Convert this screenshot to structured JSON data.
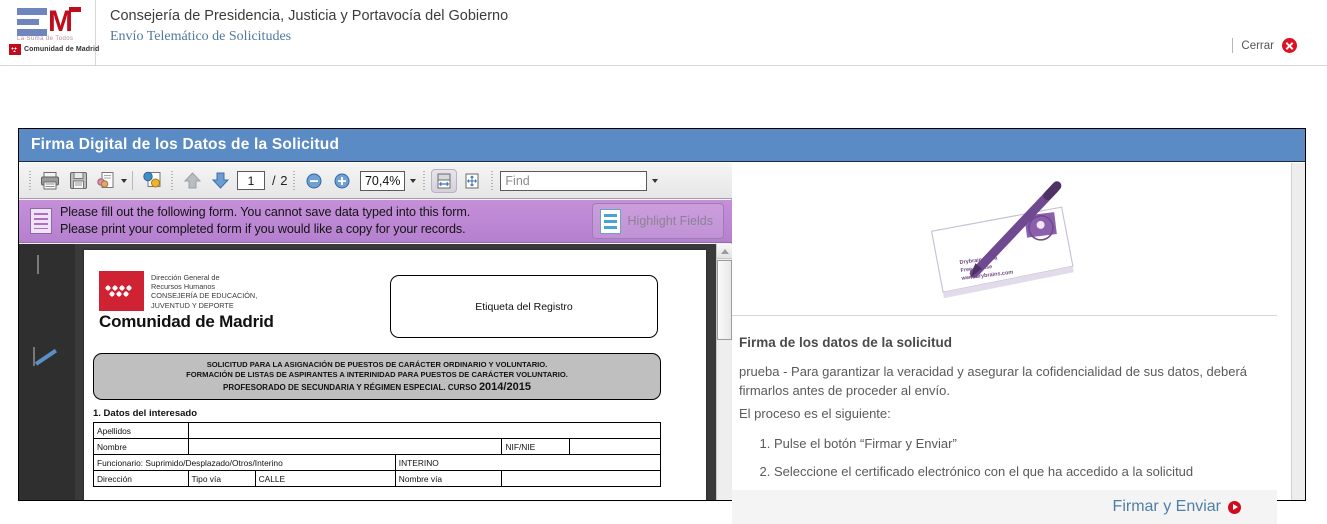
{
  "header": {
    "logo": {
      "letter_m": "M",
      "tagline": "La Suma de Todos",
      "region": "Comunidad de Madrid"
    },
    "title_main": "Consejería de Presidencia, Justicia y Portavocía del Gobierno",
    "title_sub": "Envío Telemático de Solicitudes",
    "close_label": "Cerrar"
  },
  "panel": {
    "title": "Firma Digital de los Datos de la Solicitud"
  },
  "pdf_toolbar": {
    "print_icon": "printer-icon",
    "save_icon": "floppy-disk-icon",
    "email_icon": "share-document-icon",
    "secure_icon": "secure-document-icon",
    "prev_icon": "arrow-up-icon",
    "next_icon": "arrow-down-icon",
    "page_current": "1",
    "page_total": "/ 2",
    "zoom_out_icon": "zoom-out-icon",
    "zoom_in_icon": "zoom-in-icon",
    "zoom_value": "70,4%",
    "fit_width_icon": "fit-width-icon",
    "fit_page_icon": "fit-page-icon",
    "find_placeholder": "Find",
    "find_value": ""
  },
  "notification": {
    "line1": "Please fill out the following form. You cannot save data typed into this form.",
    "line2": "Please print your completed form if you would like a copy for your records.",
    "highlight_label": "Highlight Fields"
  },
  "doc_sidebar": {
    "pages_icon": "pages-thumbnail-icon",
    "search_icon": "binoculars-search-icon",
    "signature_icon": "signature-pen-icon"
  },
  "pdf_page": {
    "logo_lines": [
      "Dirección General de",
      "Recursos Humanos",
      "CONSEJERÍA DE EDUCACIÓN,",
      "JUVENTUD Y DEPORTE"
    ],
    "comunidad": "Comunidad de Madrid",
    "etiqueta": "Etiqueta del Registro",
    "solicitud_line1": "SOLICITUD PARA LA ASIGNACIÓN DE PUESTOS DE CARÁCTER ORDINARIO Y VOLUNTARIO.",
    "solicitud_line2": "FORMACIÓN DE LISTAS DE ASPIRANTES A INTERINIDAD PARA PUESTOS DE CARÁCTER VOLUNTARIO.",
    "solicitud_line3": "PROFESORADO DE SECUNDARIA Y RÉGIMEN ESPECIAL. CURSO ",
    "solicitud_year": "2014/2015",
    "section_title": "1. Datos del interesado",
    "rows": {
      "apellidos_label": "Apellidos",
      "apellidos_value": "",
      "nombre_label": "Nombre",
      "nombre_value": "",
      "nif_label": "NIF/NIE",
      "nif_value": "",
      "funcionario_label": "Funcionario: Suprimido/Desplazado/Otros/Interino",
      "funcionario_value": "INTERINO",
      "direccion_label": "Dirección",
      "tipovia_label": "Tipo vía",
      "tipovia_value": "CALLE",
      "nombrevia_label": "Nombre vía",
      "nombrevia_value": ""
    }
  },
  "info": {
    "image_alt": "envelope-and-pen-image",
    "heading": "Firma de los datos de la solicitud",
    "paragraph1": "prueba - Para garantizar la veracidad y asegurar la cofidencialidad de sus datos, deberá firmarlos antes de proceder al envío.",
    "paragraph2": "El proceso es el siguiente:",
    "steps": [
      "Pulse el botón “Firmar y Enviar”",
      "Seleccione el certificado electrónico con el que ha accedido a la solicitud"
    ],
    "sign_button_label": "Firmar y Enviar"
  },
  "colors": {
    "panel_title_bg": "#5b8bc4",
    "notification_bg": "#bd87d4",
    "link_blue": "#52789e",
    "brand_red": "#c00d1e",
    "sign_link": "#4f7fa8"
  }
}
